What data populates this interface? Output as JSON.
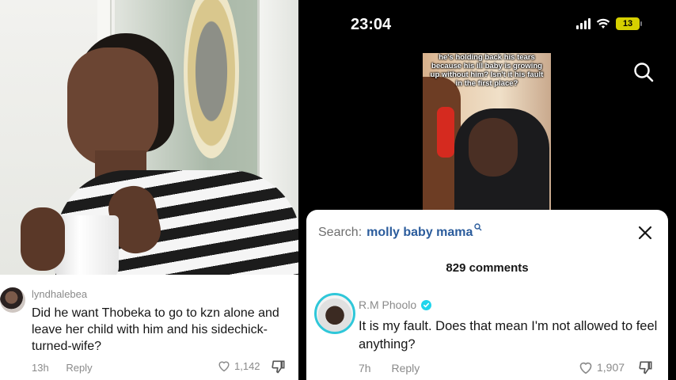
{
  "left_panel": {
    "comment": {
      "username": "lyndhalebea",
      "text": "Did he want Thobeka to go to kzn alone and leave her child with him and his sidechick-turned-wife?",
      "time": "13h",
      "reply_label": "Reply",
      "likes": "1,142",
      "icons": [
        "heart-icon",
        "dislike-icon"
      ]
    }
  },
  "right_panel": {
    "status_bar": {
      "time": "23:04",
      "battery": "13",
      "icons": [
        "signal-icon",
        "wifi-icon",
        "battery-icon"
      ]
    },
    "video_caption": "he's holding back his tears because his ill baby is growing up without him? Isn't it his fault in the first place?",
    "search_bar": {
      "prefix": "Search:",
      "query": "molly baby mama"
    },
    "comment_count": "829 comments",
    "comment": {
      "username": "R.M Phoolo",
      "verified": true,
      "text": "It is my fault. Does that mean I'm not allowed to feel anything?",
      "time": "7h",
      "reply_label": "Reply",
      "likes": "1,907"
    },
    "colors": {
      "accent_query": "#2b5c9c",
      "verified": "#20d5ec",
      "avatar_ring": "#2fc7d9",
      "battery": "#d6d000"
    }
  }
}
